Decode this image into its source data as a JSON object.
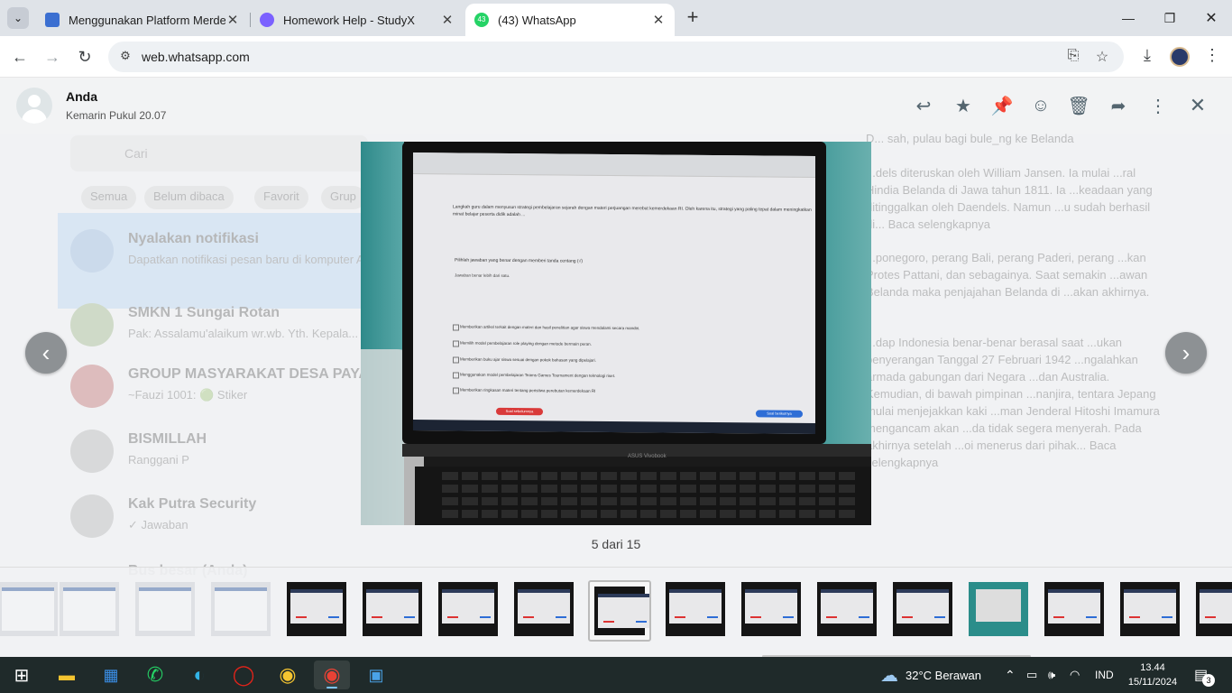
{
  "browser": {
    "tabs": [
      {
        "title": "Menggunakan Platform Merdeka",
        "active": false,
        "favicon_color": "#3b6fd1"
      },
      {
        "title": "Homework Help - StudyX",
        "active": false,
        "favicon_color": "#7b61ff"
      },
      {
        "title": "(43) WhatsApp",
        "active": true,
        "favicon_color": "#25d366",
        "badge": "43"
      }
    ],
    "url": "web.whatsapp.com"
  },
  "viewer": {
    "sender_name": "Anda",
    "sender_time": "Kemarin Pukul 20.07",
    "counter": "5 dari 15",
    "header_icons": [
      "reply-icon",
      "star-icon",
      "pin-icon",
      "emoji-icon",
      "delete-icon",
      "forward-icon",
      "more-icon",
      "close-icon"
    ],
    "photo": {
      "question": "Langkah guru dalam menyusun strategi pembelajaran sejarah dengan materi perjuangan merebut kemerdekaan RI. Oleh karena itu, strategi yang paling tepat dalam meningkatkan minat belajar peserta didik adalah ...",
      "instruction": "Pilihlah jawaban yang benar dengan memberi tanda centang (√)",
      "multi_note": "Jawaban benar lebih dari satu.",
      "options": [
        "Memberikan artikel terkait dengan materi dan hasil penelitian agar siswa mendalami secara mandiri.",
        "Memilih model pembelajaran role playing dengan metode bermain peran.",
        "Memberikan buku ajar siswa sesuai dengan pokok bahasan yang dipelajari.",
        "Menggunakan model pembelajaran Teams Games Tournament dengan teknologi riset.",
        "Memberikan ringkasan materi tentang peristiwa perebutan kemerdekaan RI"
      ],
      "prev_label": "Soal sebelumnya",
      "next_label": "Soal berikutnya",
      "brand": "ASUS Vivobook"
    }
  },
  "background_chat": {
    "filters": [
      "Semua",
      "Belum dibaca",
      "Favorit",
      "Grup"
    ],
    "search_placeholder": "Cari",
    "chats": [
      {
        "name": "Nyalakan notifikasi",
        "msg": "Dapatkan notifikasi pesan baru di komputer Anda."
      },
      {
        "name": "SMKN 1 Sungai Rotan",
        "msg": "Pak: Assalamu'alaikum wr.wb. Yth. Kepala..."
      },
      {
        "name": "GROUP MASYARAKAT DESA PAYA",
        "msg": "~Fauzi 1001: 🟢 Stiker"
      },
      {
        "name": "BISMILLAH",
        "msg": "Ranggani P"
      },
      {
        "name": "Kak Putra Security",
        "msg": "✓ Jawaban"
      },
      {
        "name": "Bus besar (Anda)",
        "msg": ""
      }
    ],
    "messages": [
      "D... sah, pulau bagi bule_ng ke Belanda",
      "...dels diteruskan oleh William Jansen. Ia mulai ...ral Hindia Belanda di Jawa tahun 1811. Ia ...keadaan yang ditinggalkan oleh Daendels. Namun ...u sudah berhasil di... Baca selengkapnya",
      "...ponegoro, perang Bali, perang Paderi, perang ...kan Protes Pattani, dan sebagainya. Saat semakin ...awan Belanda maka penjajahan Belanda di ...akan akhirnya.",
      "...dap Indonesia benar-benar berasal saat ...ukan penyerangan Tanggal 27 Februari 1942 ...ngalahkan armada gabungan dari Negara ...dan Australia. Kemudian, di bawah pimpinan ...nanjira, tentara Jepang mulai menjejakkan kaki ...man Jenderal Hitoshi Imamura mengancam akan ...da tidak segera menyerah. Pada akhirnya setelah ...oi menerus dari pihak... Baca selengkapnya"
    ]
  },
  "taskbar": {
    "weather": "32°C Berawan",
    "language": "IND",
    "time": "13.44",
    "date": "15/11/2024",
    "notifications": "3",
    "apps": [
      "start-icon",
      "file-explorer-icon",
      "microsoft-store-icon",
      "whatsapp-icon",
      "edge-icon",
      "opera-icon",
      "chrome-icon",
      "chrome-profile-icon",
      "photos-icon"
    ]
  },
  "colors": {
    "accent_green": "#25d366",
    "viewer_bg": "#f1f2f4",
    "taskbar_bg": "#1f2a2a"
  }
}
